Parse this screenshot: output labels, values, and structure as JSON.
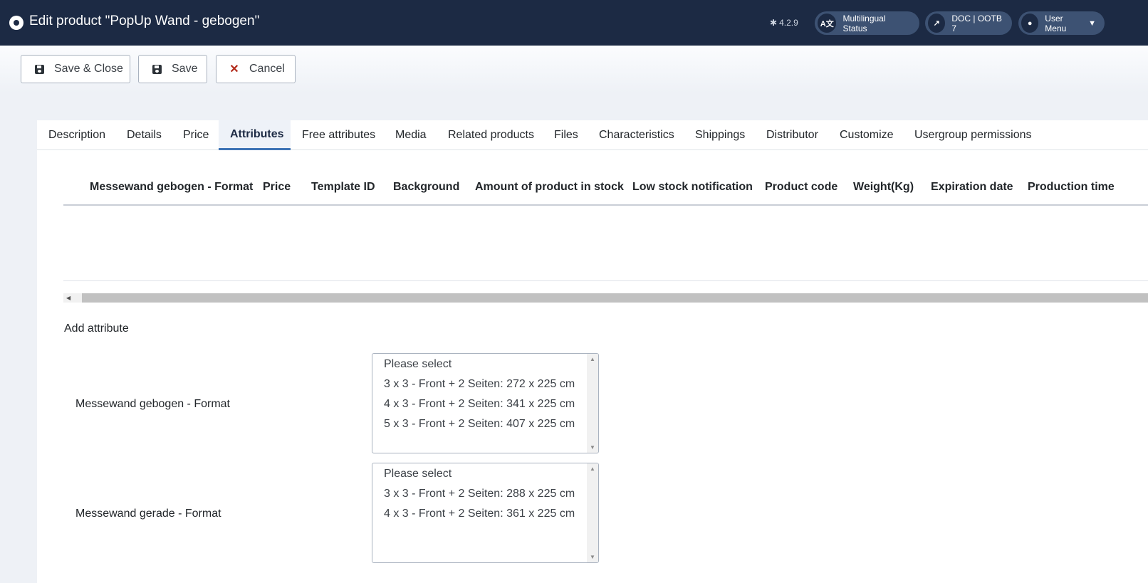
{
  "header": {
    "title": "Edit product \"PopUp Wand - gebogen\"",
    "version": "4.2.9",
    "multilingual_label": "Multilingual Status",
    "doc_label": "DOC | OOTB 7",
    "user_menu_label": "User Menu"
  },
  "toolbar": {
    "save_close_label": "Save & Close",
    "save_label": "Save",
    "cancel_label": "Cancel"
  },
  "tabs": [
    {
      "label": "Description"
    },
    {
      "label": "Details"
    },
    {
      "label": "Price"
    },
    {
      "label": "Attributes",
      "active": true
    },
    {
      "label": "Free attributes"
    },
    {
      "label": "Media"
    },
    {
      "label": "Related products"
    },
    {
      "label": "Files"
    },
    {
      "label": "Characteristics"
    },
    {
      "label": "Shippings"
    },
    {
      "label": "Distributor"
    },
    {
      "label": "Customize"
    },
    {
      "label": "Usergroup permissions"
    }
  ],
  "table": {
    "columns": [
      "Messewand gebogen - Format",
      "Price",
      "Template ID",
      "Background",
      "Amount of product in stock",
      "Low stock notification",
      "Product code",
      "Weight(Kg)",
      "Expiration date",
      "Production time"
    ]
  },
  "add_attribute": {
    "heading": "Add attribute",
    "attributes": [
      {
        "label": "Messewand gebogen - Format",
        "options": [
          "Please select",
          "3 x 3 - Front + 2 Seiten: 272 x 225 cm",
          "4 x 3 - Front + 2 Seiten: 341 x 225 cm",
          "5 x 3 - Front + 2 Seiten: 407 x 225 cm"
        ]
      },
      {
        "label": "Messewand gerade - Format",
        "options": [
          "Please select",
          "3 x 3 - Front + 2 Seiten: 288 x 225 cm",
          "4 x 3 - Front + 2 Seiten: 361 x 225 cm"
        ]
      }
    ]
  }
}
